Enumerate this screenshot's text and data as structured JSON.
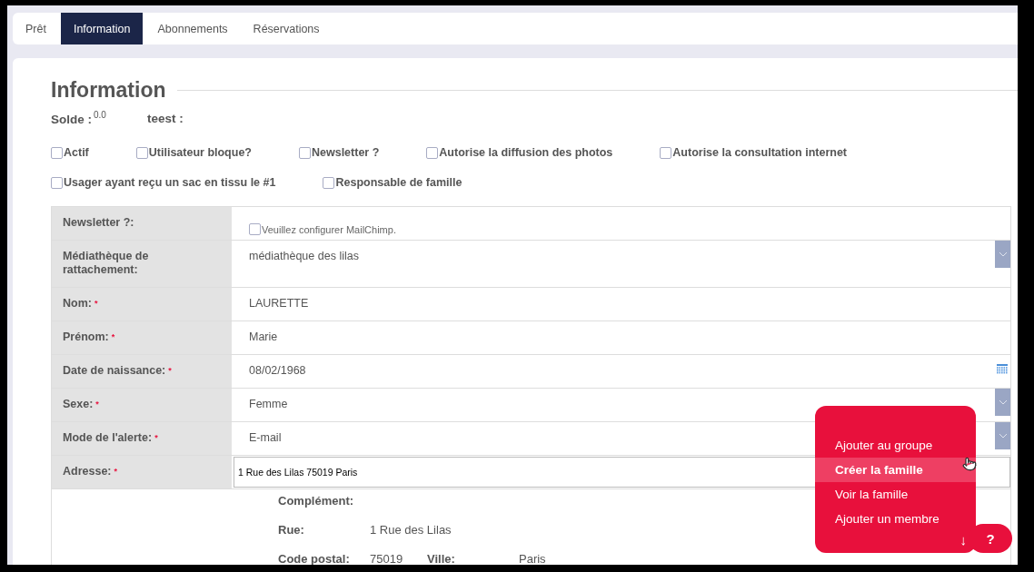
{
  "tabs": [
    {
      "label": "Prêt",
      "selected": false
    },
    {
      "label": "Information",
      "selected": true
    },
    {
      "label": "Abonnements",
      "selected": false
    },
    {
      "label": "Réservations",
      "selected": false
    }
  ],
  "section_title": "Information",
  "summary": [
    {
      "label": "Solde :",
      "value": "0.0"
    },
    {
      "label": "teest :"
    }
  ],
  "checkbox_rows": [
    [
      {
        "label": "Actif",
        "checked": false
      },
      {
        "label": "Utilisateur bloque?",
        "checked": false
      },
      {
        "label": "Newsletter ?",
        "checked": false
      },
      {
        "label": "Autorise la diffusion des photos",
        "checked": false
      },
      {
        "label": "Autorise la consultation internet",
        "checked": false
      }
    ],
    [
      {
        "label": "Usager ayant reçu un sac en tissu le #1",
        "checked": false
      },
      {
        "label": "Responsable de famille",
        "checked": false
      }
    ]
  ],
  "form_rows": [
    {
      "label": "Newsletter ?:",
      "kind": "checkbox",
      "checked": false,
      "value": "Veuillez configurer MailChimp."
    },
    {
      "label": "Médiathèque de rattachement:",
      "kind": "select",
      "value": "médiathèque des lilas"
    },
    {
      "label": "Nom:",
      "mark": "*",
      "kind": "text",
      "value": "LAURETTE"
    },
    {
      "label": "Prénom:",
      "mark": "*",
      "kind": "text",
      "value": "Marie"
    },
    {
      "label": "Date de naissance:",
      "mark": "*",
      "kind": "date",
      "value": "08/02/1968"
    },
    {
      "label": "Sexe:",
      "mark": "*",
      "kind": "select",
      "value": "Femme"
    },
    {
      "label": "Mode de l'alerte:",
      "mark": "*",
      "kind": "select",
      "value": "E-mail"
    },
    {
      "label": "Adresse:",
      "mark": "*",
      "kind": "input",
      "value": "1 Rue des Lilas 75019 Paris"
    }
  ],
  "address_details": [
    [
      {
        "label": "Complément:"
      }
    ],
    [
      {
        "label": "Rue:",
        "value": "1 Rue des Lilas"
      }
    ],
    [
      {
        "label": "Code postal:",
        "value": "75019"
      },
      {
        "label": "Ville:",
        "value": "Paris"
      }
    ]
  ],
  "action_menu": {
    "items": [
      {
        "label": "Ajouter au groupe",
        "selected": false
      },
      {
        "label": "Créer la famille",
        "selected": true
      },
      {
        "label": "Voir la famille",
        "selected": false
      },
      {
        "label": "Ajouter un membre",
        "selected": false
      }
    ],
    "scroll_arrow": "↓",
    "help": "?"
  }
}
